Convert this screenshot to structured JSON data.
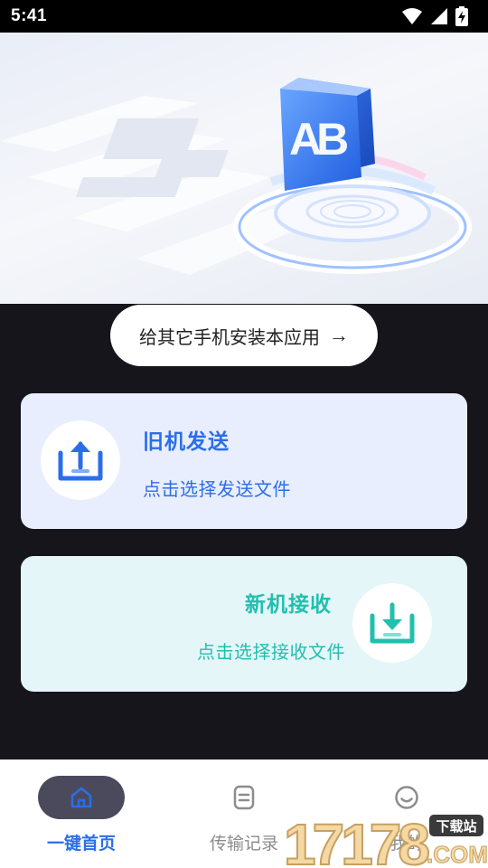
{
  "status_bar": {
    "time": "5:41"
  },
  "install_button": {
    "label": "给其它手机安装本应用",
    "arrow": "→"
  },
  "send_card": {
    "title": "旧机发送",
    "subtitle": "点击选择发送文件",
    "icon": "upload-tray-icon"
  },
  "receive_card": {
    "title": "新机接收",
    "subtitle": "点击选择接收文件",
    "icon": "download-tray-icon"
  },
  "bottom_nav": {
    "items": [
      {
        "label": "一键首页",
        "icon": "home-icon",
        "active": true
      },
      {
        "label": "传输记录",
        "icon": "document-icon",
        "active": false
      },
      {
        "label": "我的",
        "icon": "smiley-icon",
        "active": false
      }
    ]
  },
  "watermark": {
    "digits": "17178",
    "badge": "下载站",
    "domain": ".COM"
  },
  "colors": {
    "accent_blue": "#2b6ee8",
    "accent_teal": "#22bfae",
    "background": "#17151c",
    "nav_active_pill": "#4b4a5c"
  }
}
